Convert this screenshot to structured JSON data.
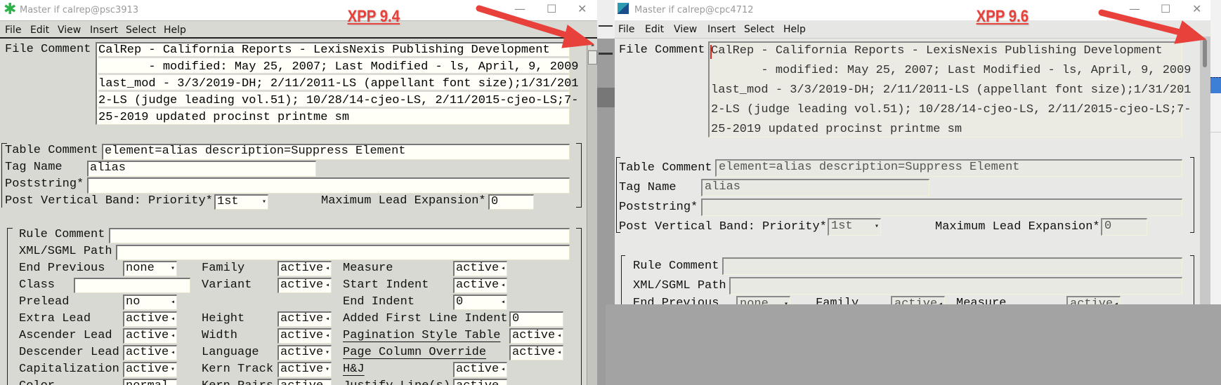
{
  "colors": {
    "annotation": "#e8403a",
    "left_bg": "#d9d9d4",
    "right_bg": "#e8e8e6",
    "overlay": "#a3a3a3"
  },
  "annotations": {
    "left": "XPP 9.4",
    "right": "XPP 9.6"
  },
  "left": {
    "title": "Master if calrep@psc3913",
    "app_icon": "green-asterisk-icon",
    "menu": [
      "File",
      "Edit",
      "View",
      "Insert",
      "Select",
      "Help"
    ],
    "file_comment": {
      "label": "File Comment",
      "lines": [
        "CalRep - California Reports - LexisNexis Publishing Development",
        "       - modified: May 25, 2007; Last Modified - ls, April, 9, 2009",
        "last_mod - 3/3/2019-DH; 2/11/2011-LS (appellant font size);1/31/201",
        "2-LS (judge leading vol.51); 10/28/14-cjeo-LS, 2/11/2015-cjeo-LS;7-",
        "25-2019 updated procinst printme sm"
      ]
    },
    "table_comment": {
      "label": "Table Comment",
      "value": "element=alias description=Suppress Element"
    },
    "tag_name": {
      "label": "Tag Name",
      "value": "alias"
    },
    "poststring": {
      "label": "Poststring*",
      "value": ""
    },
    "priority": {
      "label": "Post Vertical Band: Priority*",
      "value": "1st"
    },
    "max_lead": {
      "label": "Maximum Lead Expansion*",
      "value": "0"
    },
    "rule_comment": {
      "label": "Rule Comment",
      "value": ""
    },
    "xml_path": {
      "label": "XML/SGML Path",
      "value": ""
    },
    "rows": [
      [
        {
          "label": "End Previous",
          "value": "none",
          "arrow": "▾"
        },
        {
          "label": "Family",
          "value": "active",
          "arrow": "◂"
        },
        {
          "label": "Measure",
          "value": "active",
          "arrow": "◂"
        }
      ],
      [
        {
          "label": "Class",
          "value": ""
        },
        {
          "label": "Variant",
          "value": "active",
          "arrow": "◂"
        },
        {
          "label": "Start Indent",
          "value": "active",
          "arrow": "◂"
        }
      ],
      [
        {
          "label": "Prelead",
          "value": "no",
          "arrow": "◂"
        },
        {
          "label": "",
          "value": ""
        },
        {
          "label": "End Indent",
          "value": "0",
          "arrow": "◂"
        }
      ],
      [
        {
          "label": "Extra Lead",
          "value": "active",
          "arrow": "◂"
        },
        {
          "label": "Height",
          "value": "active",
          "arrow": "◂"
        },
        {
          "label": "Added First Line Indent",
          "value": "0"
        }
      ],
      [
        {
          "label": "Ascender Lead",
          "value": "active",
          "arrow": "◂"
        },
        {
          "label": "Width",
          "value": "active",
          "arrow": "◂"
        },
        {
          "label": "Pagination Style Table",
          "value": "active",
          "arrow": "◂"
        }
      ],
      [
        {
          "label": "Descender Lead",
          "value": "active",
          "arrow": "◂"
        },
        {
          "label": "Language",
          "value": "active",
          "arrow": "▾"
        },
        {
          "label": "Page Column Override",
          "value": "active",
          "arrow": "◂"
        }
      ],
      [
        {
          "label": "Capitalization",
          "value": "active",
          "arrow": "▾"
        },
        {
          "label": "Kern Track",
          "value": "active",
          "arrow": "▾"
        },
        {
          "label": "H&J",
          "value": "active",
          "arrow": "◂"
        }
      ],
      [
        {
          "label": "Color",
          "value": "normal"
        },
        {
          "label": "Kern Pairs",
          "value": "active"
        },
        {
          "label": "Justify Line(s)",
          "value": "active"
        }
      ]
    ]
  },
  "right": {
    "title": "Master if calrep@cpc4712",
    "app_icon": "xpp-logo-icon",
    "menu": [
      "File",
      "Edit",
      "View",
      "Insert",
      "Select",
      "Help"
    ],
    "file_comment": {
      "label": "File Comment",
      "lines": [
        "CalRep - California Reports - LexisNexis Publishing Development",
        "       - modified: May 25, 2007; Last Modified - ls, April, 9, 2009",
        "last_mod - 3/3/2019-DH; 2/11/2011-LS (appellant font size);1/31/201",
        "2-LS (judge leading vol.51); 10/28/14-cjeo-LS, 2/11/2015-cjeo-LS;7-",
        "25-2019 updated procinst printme sm"
      ]
    },
    "table_comment": {
      "label": "Table Comment",
      "value": "element=alias description=Suppress Element"
    },
    "tag_name": {
      "label": "Tag Name",
      "value": "alias"
    },
    "poststring": {
      "label": "Poststring*",
      "value": ""
    },
    "priority": {
      "label": "Post Vertical Band: Priority*",
      "value": "1st"
    },
    "max_lead": {
      "label": "Maximum Lead Expansion*",
      "value": "0"
    },
    "rule_comment": {
      "label": "Rule Comment",
      "value": ""
    },
    "xml_path": {
      "label": "XML/SGML Path",
      "value": ""
    },
    "rows": [
      [
        {
          "label": "End Previous",
          "value": "none",
          "arrow": "▾"
        },
        {
          "label": "Family",
          "value": "active",
          "arrow": "◂"
        },
        {
          "label": "Measure",
          "value": "active",
          "arrow": "◂"
        }
      ]
    ]
  }
}
